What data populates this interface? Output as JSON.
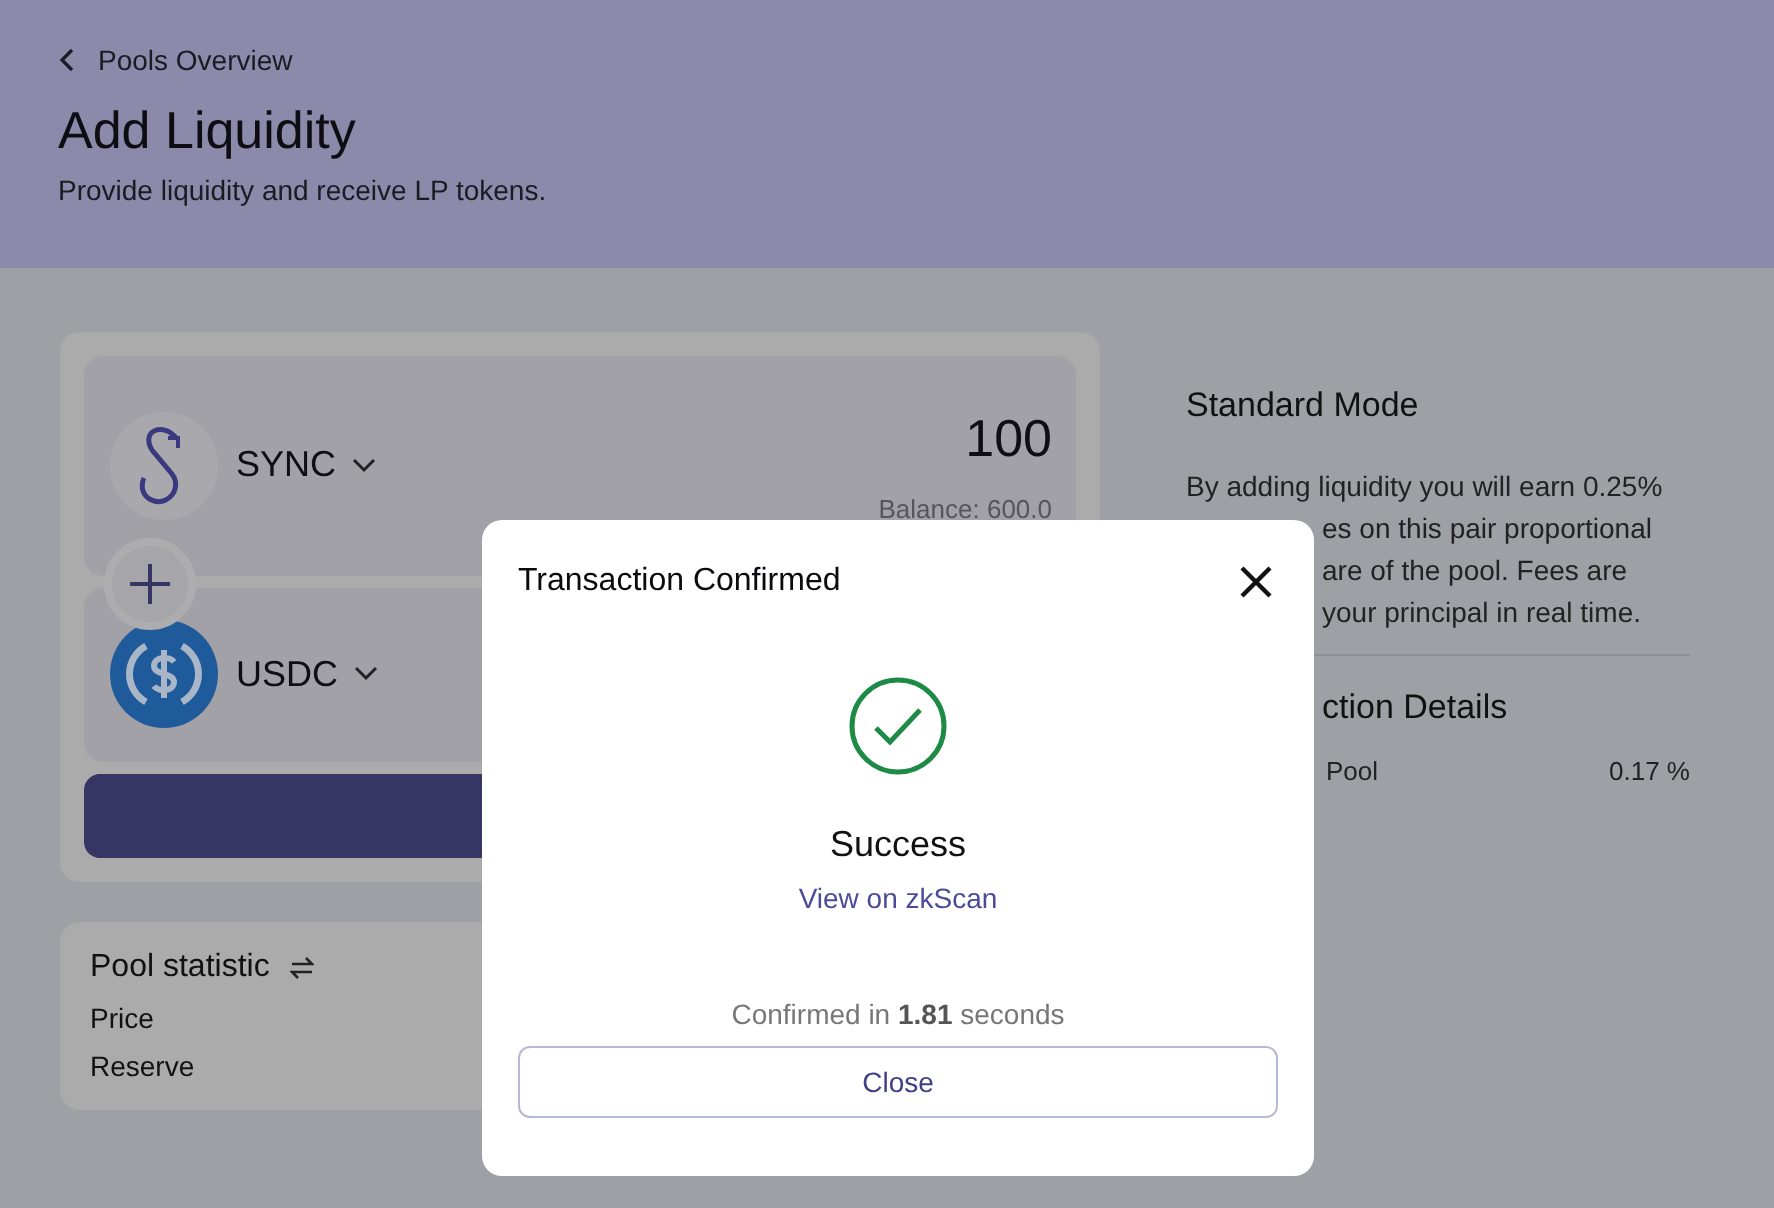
{
  "header": {
    "back_link": "Pools Overview",
    "title": "Add Liquidity",
    "subtitle": "Provide liquidity and receive LP tokens."
  },
  "tokens": [
    {
      "symbol": "SYNC",
      "kind": "sync",
      "amount": "100",
      "balance": "Balance: 600.0"
    },
    {
      "symbol": "USDC",
      "kind": "usdc"
    }
  ],
  "pool_statistic": {
    "title": "Pool statistic",
    "rows": [
      "Price",
      "Reserve"
    ]
  },
  "info": {
    "title": "Standard Mode",
    "lines": [
      {
        "text": "By adding liquidity you will earn 0.25%",
        "kind": "full"
      },
      {
        "text": "es on this pair proportional",
        "kind": "cut"
      },
      {
        "text": "are of the pool. Fees are",
        "kind": "cut"
      },
      {
        "text": "your principal in real time.",
        "kind": "cut"
      }
    ],
    "details_title": "ction Details",
    "details": [
      {
        "label": "Pool",
        "value": "0.17 %"
      }
    ]
  },
  "dialog": {
    "title": "Transaction Confirmed",
    "status": "Success",
    "link": "View on zkScan",
    "confirmed": "Confirmed in **1.81** seconds",
    "button": "Close"
  }
}
